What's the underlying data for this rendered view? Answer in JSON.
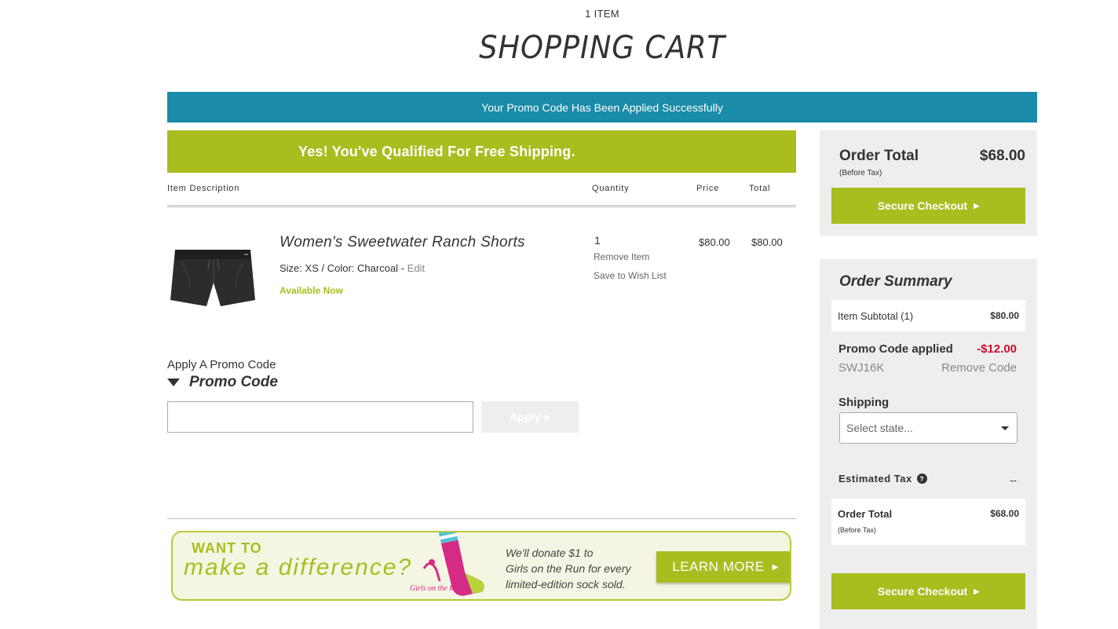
{
  "header": {
    "item_count": "1 ITEM",
    "title": "SHOPPING CART"
  },
  "banners": {
    "promo_applied": "Your Promo Code Has Been Applied Successfully",
    "free_shipping": "Yes! You've Qualified For Free Shipping."
  },
  "cart_table": {
    "columns": {
      "description": "Item Description",
      "quantity": "Quantity",
      "price": "Price",
      "total": "Total"
    },
    "items": [
      {
        "name": "Women's Sweetwater Ranch Shorts",
        "size_label": "Size:",
        "size": "XS",
        "color_label": "Color:",
        "color": "Charcoal",
        "edit": "Edit",
        "availability": "Available Now",
        "quantity": "1",
        "remove": "Remove Item",
        "save": "Save to Wish List",
        "price": "$80.00",
        "total": "$80.00"
      }
    ]
  },
  "promo": {
    "label": "Apply A Promo Code",
    "toggle": "Promo Code",
    "input_value": "",
    "apply": "Apply"
  },
  "donate_banner": {
    "want_to": "WANT TO",
    "make_difference": "make a difference?",
    "text_line1": "We'll donate $1 to",
    "text_line2": "Girls on the Run for every",
    "text_line3": "limited-edition sock sold.",
    "learn_more": "LEARN MORE",
    "logo_text": "Girls on the Run"
  },
  "order_total": {
    "label": "Order Total",
    "sub": "(Before Tax)",
    "amount": "$68.00",
    "checkout": "Secure Checkout"
  },
  "summary": {
    "title": "Order Summary",
    "subtotal_label": "Item Subtotal (1)",
    "subtotal_amount": "$80.00",
    "promo_label": "Promo Code applied",
    "promo_discount": "-$12.00",
    "promo_code": "SWJ16K",
    "remove_code": "Remove Code",
    "shipping_label": "Shipping",
    "state_placeholder": "Select state...",
    "tax_label": "Estimated Tax",
    "tax_value": "--",
    "total_label": "Order Total",
    "total_sub": "(Before Tax)",
    "total_amount": "$68.00",
    "checkout": "Secure Checkout"
  },
  "colors": {
    "accent_green": "#a9bd1f",
    "banner_teal": "#1a8ba8",
    "discount_red": "#c8102e",
    "panel_gray": "#eeeeee"
  }
}
